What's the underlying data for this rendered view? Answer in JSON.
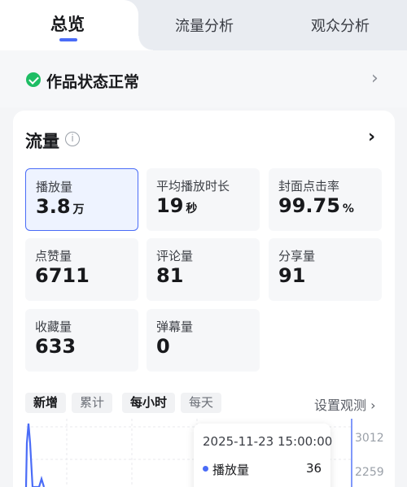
{
  "tabs": {
    "overview": "总览",
    "flow": "流量分析",
    "audience": "观众分析"
  },
  "status": {
    "text": "作品状态正常",
    "arrow": "›"
  },
  "traffic": {
    "title": "流量",
    "info_glyph": "i",
    "arrow": "›",
    "metrics": [
      {
        "label": "播放量",
        "value": "3.8",
        "unit": "万"
      },
      {
        "label": "平均播放时长",
        "value": "19",
        "unit": "秒"
      },
      {
        "label": "封面点击率",
        "value": "99.75",
        "unit": "%"
      },
      {
        "label": "点赞量",
        "value": "6711"
      },
      {
        "label": "评论量",
        "value": "81"
      },
      {
        "label": "分享量",
        "value": "91"
      },
      {
        "label": "收藏量",
        "value": "633"
      },
      {
        "label": "弹幕量",
        "value": "0"
      }
    ]
  },
  "filters": {
    "new": "新增",
    "cumulative": "累计",
    "hourly": "每小时",
    "daily": "每天",
    "settings": "设置观测 ›"
  },
  "chart_data": {
    "type": "line",
    "y_ticks": [
      "3012",
      "2259"
    ],
    "tooltip": {
      "time": "2025-11-23 15:00:00",
      "series": "播放量",
      "value": "36"
    }
  },
  "colors": {
    "accent": "#4a6cf7",
    "success": "#1ebd64"
  }
}
